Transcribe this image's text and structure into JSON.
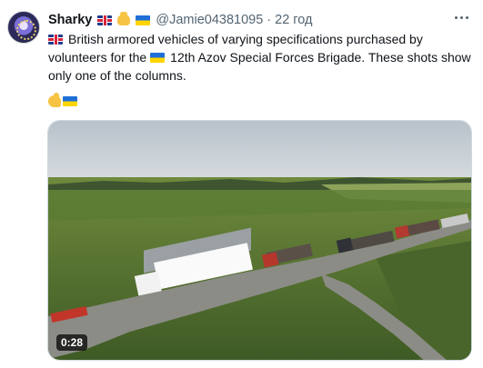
{
  "tweet": {
    "author_name": "Sharky",
    "author_handle": "@Jamie04381095",
    "separator": "·",
    "time": "22 год",
    "text_line1": "British armored vehicles of varying specifications purchased by",
    "text_line2a": "volunteers for the",
    "text_line2b": "12th Azov Special Forces Brigade.  These shots show",
    "text_line3": "only one of the columns.",
    "icons": [
      "uk-flag",
      "handshake",
      "ukraine-flag",
      "flexed-biceps"
    ],
    "video": {
      "duration": "0:28"
    }
  },
  "colors": {
    "text": "#0f1419",
    "secondary": "#536471",
    "ua_blue": "#1f6fd6",
    "ua_yellow": "#ffd500"
  }
}
